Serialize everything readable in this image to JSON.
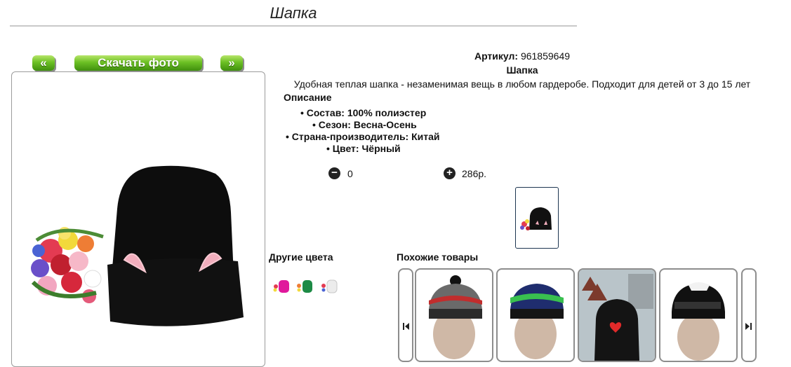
{
  "header": {
    "title": "Шапка"
  },
  "gallery": {
    "prev_label": "«",
    "download_label": "Скачать фото",
    "next_label": "»"
  },
  "product": {
    "article_label": "Артикул:",
    "article_value": "961859649",
    "name": "Шапка",
    "description": "Удобная теплая шапка - незаменимая вещь в любом гардеробе. Подходит для детей от 3 до 15 лет",
    "desc_heading": "Описание",
    "specs": [
      "Состав: 100% полиэстер",
      "Сезон: Весна-Осень",
      "Страна-производитель: Китай",
      "Цвет: Чёрный"
    ],
    "quantity": "0",
    "price": "286р."
  },
  "other_colors": {
    "heading": "Другие цвета",
    "swatches": [
      "#e0189c",
      "#1d8a45",
      "#e8e8e8"
    ]
  },
  "similar": {
    "heading": "Похожие товары"
  },
  "icons": {
    "prev": "double-left-arrow",
    "next": "double-right-arrow",
    "minus": "minus-circle-icon",
    "plus": "plus-circle-icon",
    "carousel_prev": "skip-back-icon",
    "carousel_next": "skip-forward-icon"
  }
}
